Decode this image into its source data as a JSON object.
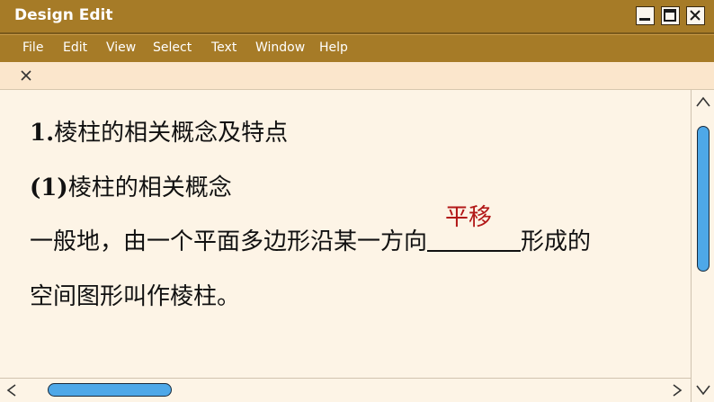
{
  "window": {
    "title": "Design Edit",
    "controls": [
      "minimize-icon",
      "maximize-icon",
      "close-icon"
    ]
  },
  "menu": [
    "File",
    "Edit",
    "View",
    "Select",
    "Text",
    "Window",
    "Help"
  ],
  "tab": {
    "close_icon": "close-icon"
  },
  "document": {
    "heading": {
      "number": "1.",
      "text": "棱柱的相关概念及特点"
    },
    "subheading": {
      "number": "(1)",
      "text": "棱柱的相关概念"
    },
    "paragraph": {
      "before_blank": "一般地，由一个平面多边形沿某一方向",
      "blank_answer": "平移",
      "after_blank": "形成的",
      "line2": "空间图形叫作棱柱。"
    }
  },
  "scrollbars": {
    "vertical": {
      "up_icon": "chevron-up-icon",
      "down_icon": "chevron-down-icon"
    },
    "horizontal": {
      "left_icon": "chevron-left-icon",
      "right_icon": "chevron-right-icon"
    }
  },
  "colors": {
    "chrome": "#a67b27",
    "tab_bar": "#fbe6cc",
    "page": "#fdf4e6",
    "answer": "#b21818",
    "scroll_thumb": "#4ea8e8"
  }
}
